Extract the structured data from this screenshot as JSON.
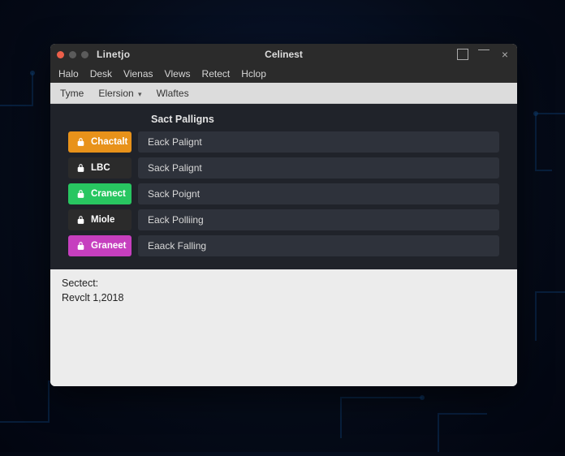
{
  "titlebar": {
    "left_label": "Linetjo",
    "title": "Celinest"
  },
  "menubar": [
    "Halo",
    "Desk",
    "Vienas",
    "Vlews",
    "Retect",
    "Hclop"
  ],
  "toolbar": {
    "items": [
      {
        "label": "Tyme",
        "dropdown": false
      },
      {
        "label": "Elersion",
        "dropdown": true
      },
      {
        "label": "Wlaftes",
        "dropdown": false
      }
    ]
  },
  "section_title": "Sact Palligns",
  "colors": {
    "row0": "#e8921a",
    "row1": "#2b2b2b",
    "row2": "#28c661",
    "row3": "#2b2b2b",
    "row4": "#c63fbf"
  },
  "rows": [
    {
      "pill": "Chactalt",
      "text": "Eack Palignt",
      "icon": "lock-icon"
    },
    {
      "pill": "LBC",
      "text": "Sack Palignt",
      "icon": "lock-icon"
    },
    {
      "pill": "Cranect",
      "text": "Sack Poignt",
      "icon": "lock-icon"
    },
    {
      "pill": "Miole",
      "text": "Eack Polliing",
      "icon": "lock-icon"
    },
    {
      "pill": "Graneet",
      "text": "Eaack Falling",
      "icon": "lock-icon"
    }
  ],
  "footer": {
    "line1": "Sectect:",
    "line2": "Revclt 1,2018"
  }
}
